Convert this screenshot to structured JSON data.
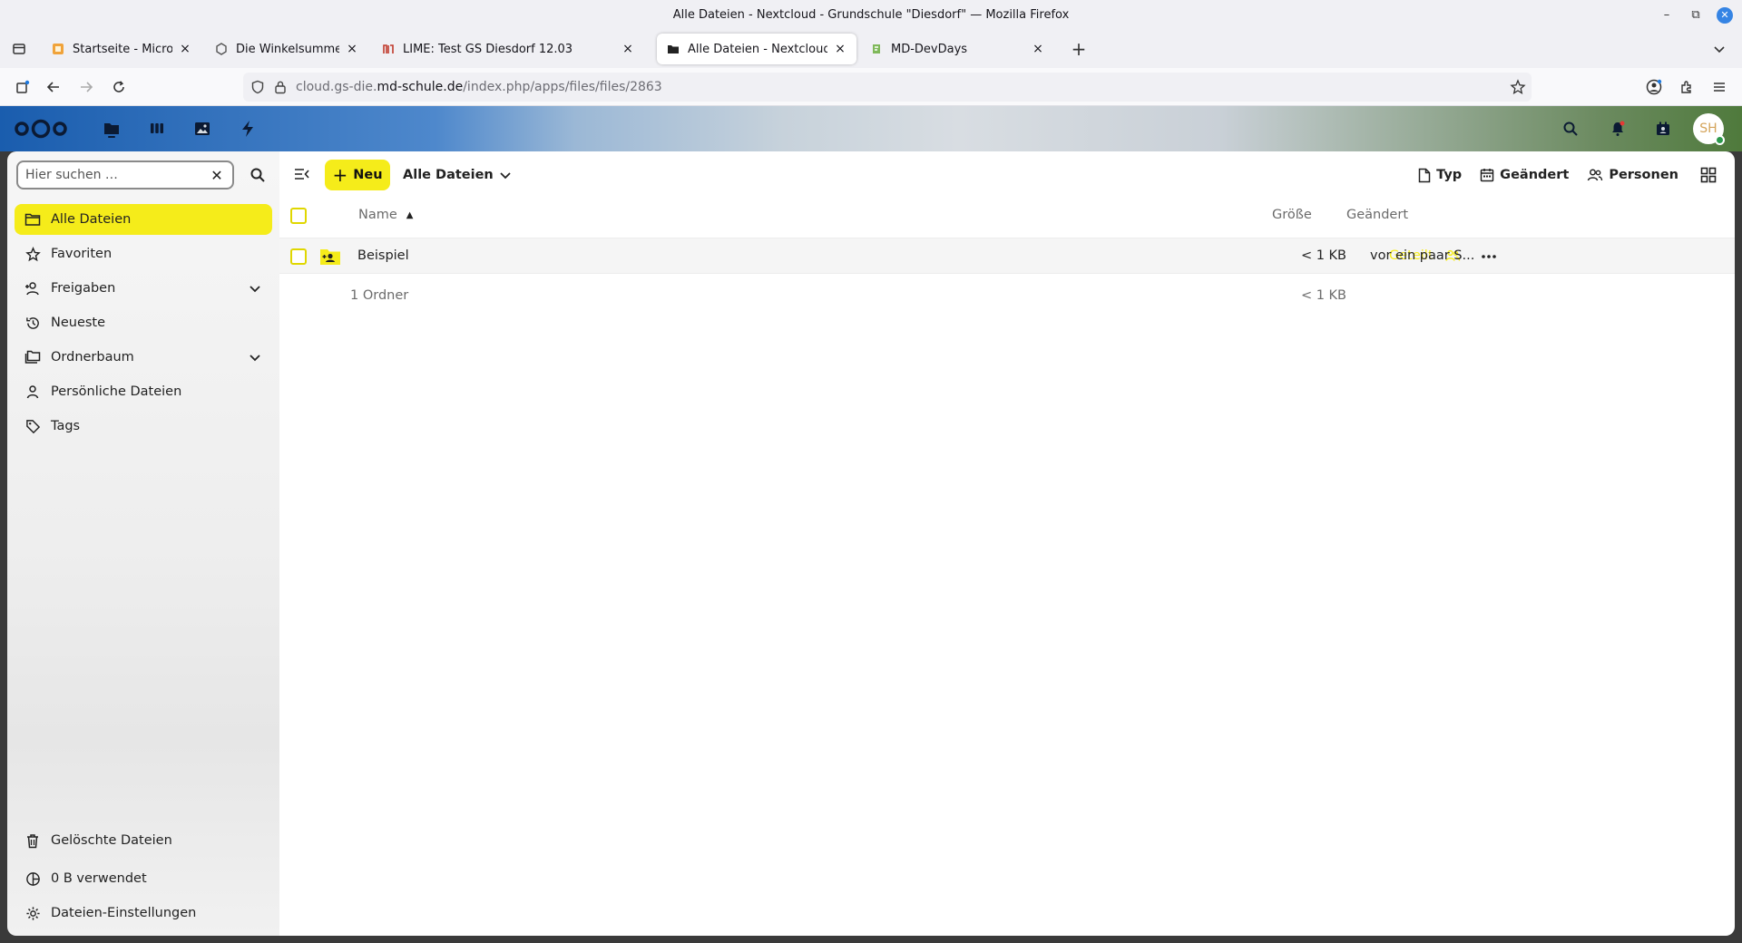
{
  "window": {
    "title": "Alle Dateien - Nextcloud - Grundschule \"Diesdorf\" — Mozilla Firefox",
    "minimize": "–",
    "maximize": "⧉",
    "close": "✕"
  },
  "tabs": [
    {
      "label": "Startseite - Microblocks",
      "favicon": "microblocks-icon"
    },
    {
      "label": "Die Winkelsumme im Dreieck",
      "favicon": "puzzle-icon"
    },
    {
      "label": "LIME: Test GS Diesdorf 12.03",
      "favicon": "lime-icon"
    },
    {
      "label": "Alle Dateien - Nextcloud - Grundschule",
      "favicon": "folder-icon",
      "active": true
    },
    {
      "label": "MD-DevDays",
      "favicon": "devdays-icon"
    }
  ],
  "tab_close": "×",
  "new_tab": "+",
  "url": {
    "prefix": "cloud.gs-die.",
    "domain": "md-schule.de",
    "path": "/index.php/apps/files/files/2863"
  },
  "nextcloud": {
    "avatar_initials": "SH",
    "search": {
      "placeholder": "Hier suchen …",
      "clear": "✕"
    },
    "nav": [
      {
        "label": "Alle Dateien",
        "icon": "folder-icon",
        "active": true
      },
      {
        "label": "Favoriten",
        "icon": "star-icon"
      },
      {
        "label": "Freigaben",
        "icon": "share-icon",
        "expandable": true
      },
      {
        "label": "Neueste",
        "icon": "history-icon"
      },
      {
        "label": "Ordnerbaum",
        "icon": "folder-tree-icon",
        "expandable": true
      },
      {
        "label": "Persönliche Dateien",
        "icon": "person-icon"
      },
      {
        "label": "Tags",
        "icon": "tag-icon"
      }
    ],
    "nav_bottom": [
      {
        "label": "Gelöschte Dateien",
        "icon": "trash-icon"
      },
      {
        "label": "0 B verwendet",
        "icon": "quota-icon"
      },
      {
        "label": "Dateien-Einstellungen",
        "icon": "gear-icon"
      }
    ],
    "toolbar": {
      "new_label": "Neu",
      "new_plus": "+",
      "breadcrumb": "Alle Dateien",
      "filters": [
        "Typ",
        "Geändert",
        "Personen"
      ]
    },
    "table": {
      "col_name": "Name",
      "col_size": "Größe",
      "col_modified": "Geändert",
      "sort_arrow": "▲",
      "rows": [
        {
          "name": "Beispiel",
          "shared_label": "Geteilt",
          "size": "< 1 KB",
          "modified": "vor ein paar S..."
        }
      ],
      "summary": {
        "count": "1 Ordner",
        "size": "< 1 KB"
      }
    },
    "colors": {
      "accent": "#f5ec1a"
    }
  }
}
